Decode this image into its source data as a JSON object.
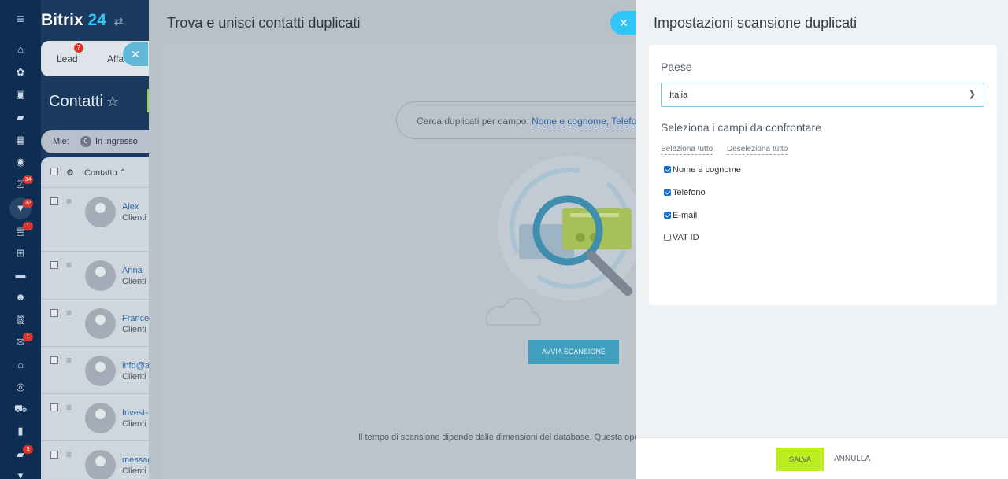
{
  "sidebar": {
    "badges": [
      "34",
      "32",
      "1",
      "1",
      "3"
    ]
  },
  "crm": {
    "brand_name": "Bitrix",
    "brand_number": "24",
    "tabs": [
      {
        "label": "Lead",
        "badge": "7"
      },
      {
        "label": "Affa"
      }
    ],
    "page_title": "Contatti",
    "filter": {
      "label": "Mie:",
      "count": "0",
      "status": "In ingresso"
    },
    "table": {
      "column_contact": "Contatto",
      "rows": [
        {
          "name": "Alex",
          "type": "Clienti"
        },
        {
          "name": "Anna",
          "type": "Clienti"
        },
        {
          "name": "France",
          "type": "Clienti"
        },
        {
          "name": "info@a",
          "type": "Clienti"
        },
        {
          "name": "Invest-",
          "type": "Clienti"
        },
        {
          "name": "messag",
          "type": "Clienti"
        }
      ]
    }
  },
  "middle": {
    "title": "Trova e unisci contatti duplicati",
    "search_label": "Cerca duplicati per campo:",
    "search_fields": "Nome e cognome, Telefo",
    "scan_button": "AVVIA SCANSIONE",
    "scan_note": "Il tempo di scansione dipende dalle dimensioni del database. Questa ope"
  },
  "settings": {
    "title": "Impostazioni scansione duplicati",
    "country_label": "Paese",
    "country_value": "Italia",
    "fields_heading": "Seleziona i campi da confrontare",
    "select_all": "Seleziona tutto",
    "deselect_all": "Deseleziona tutto",
    "fields": [
      {
        "label": "Nome e cognome",
        "checked": true
      },
      {
        "label": "Telefono",
        "checked": true
      },
      {
        "label": "E-mail",
        "checked": true
      },
      {
        "label": "VAT ID",
        "checked": false
      }
    ],
    "save_button": "SALVA",
    "cancel_button": "ANNULLA"
  },
  "colors": {
    "accent": "#2fc6f6",
    "save": "#bbed21",
    "sidebar": "#0d2d52"
  }
}
